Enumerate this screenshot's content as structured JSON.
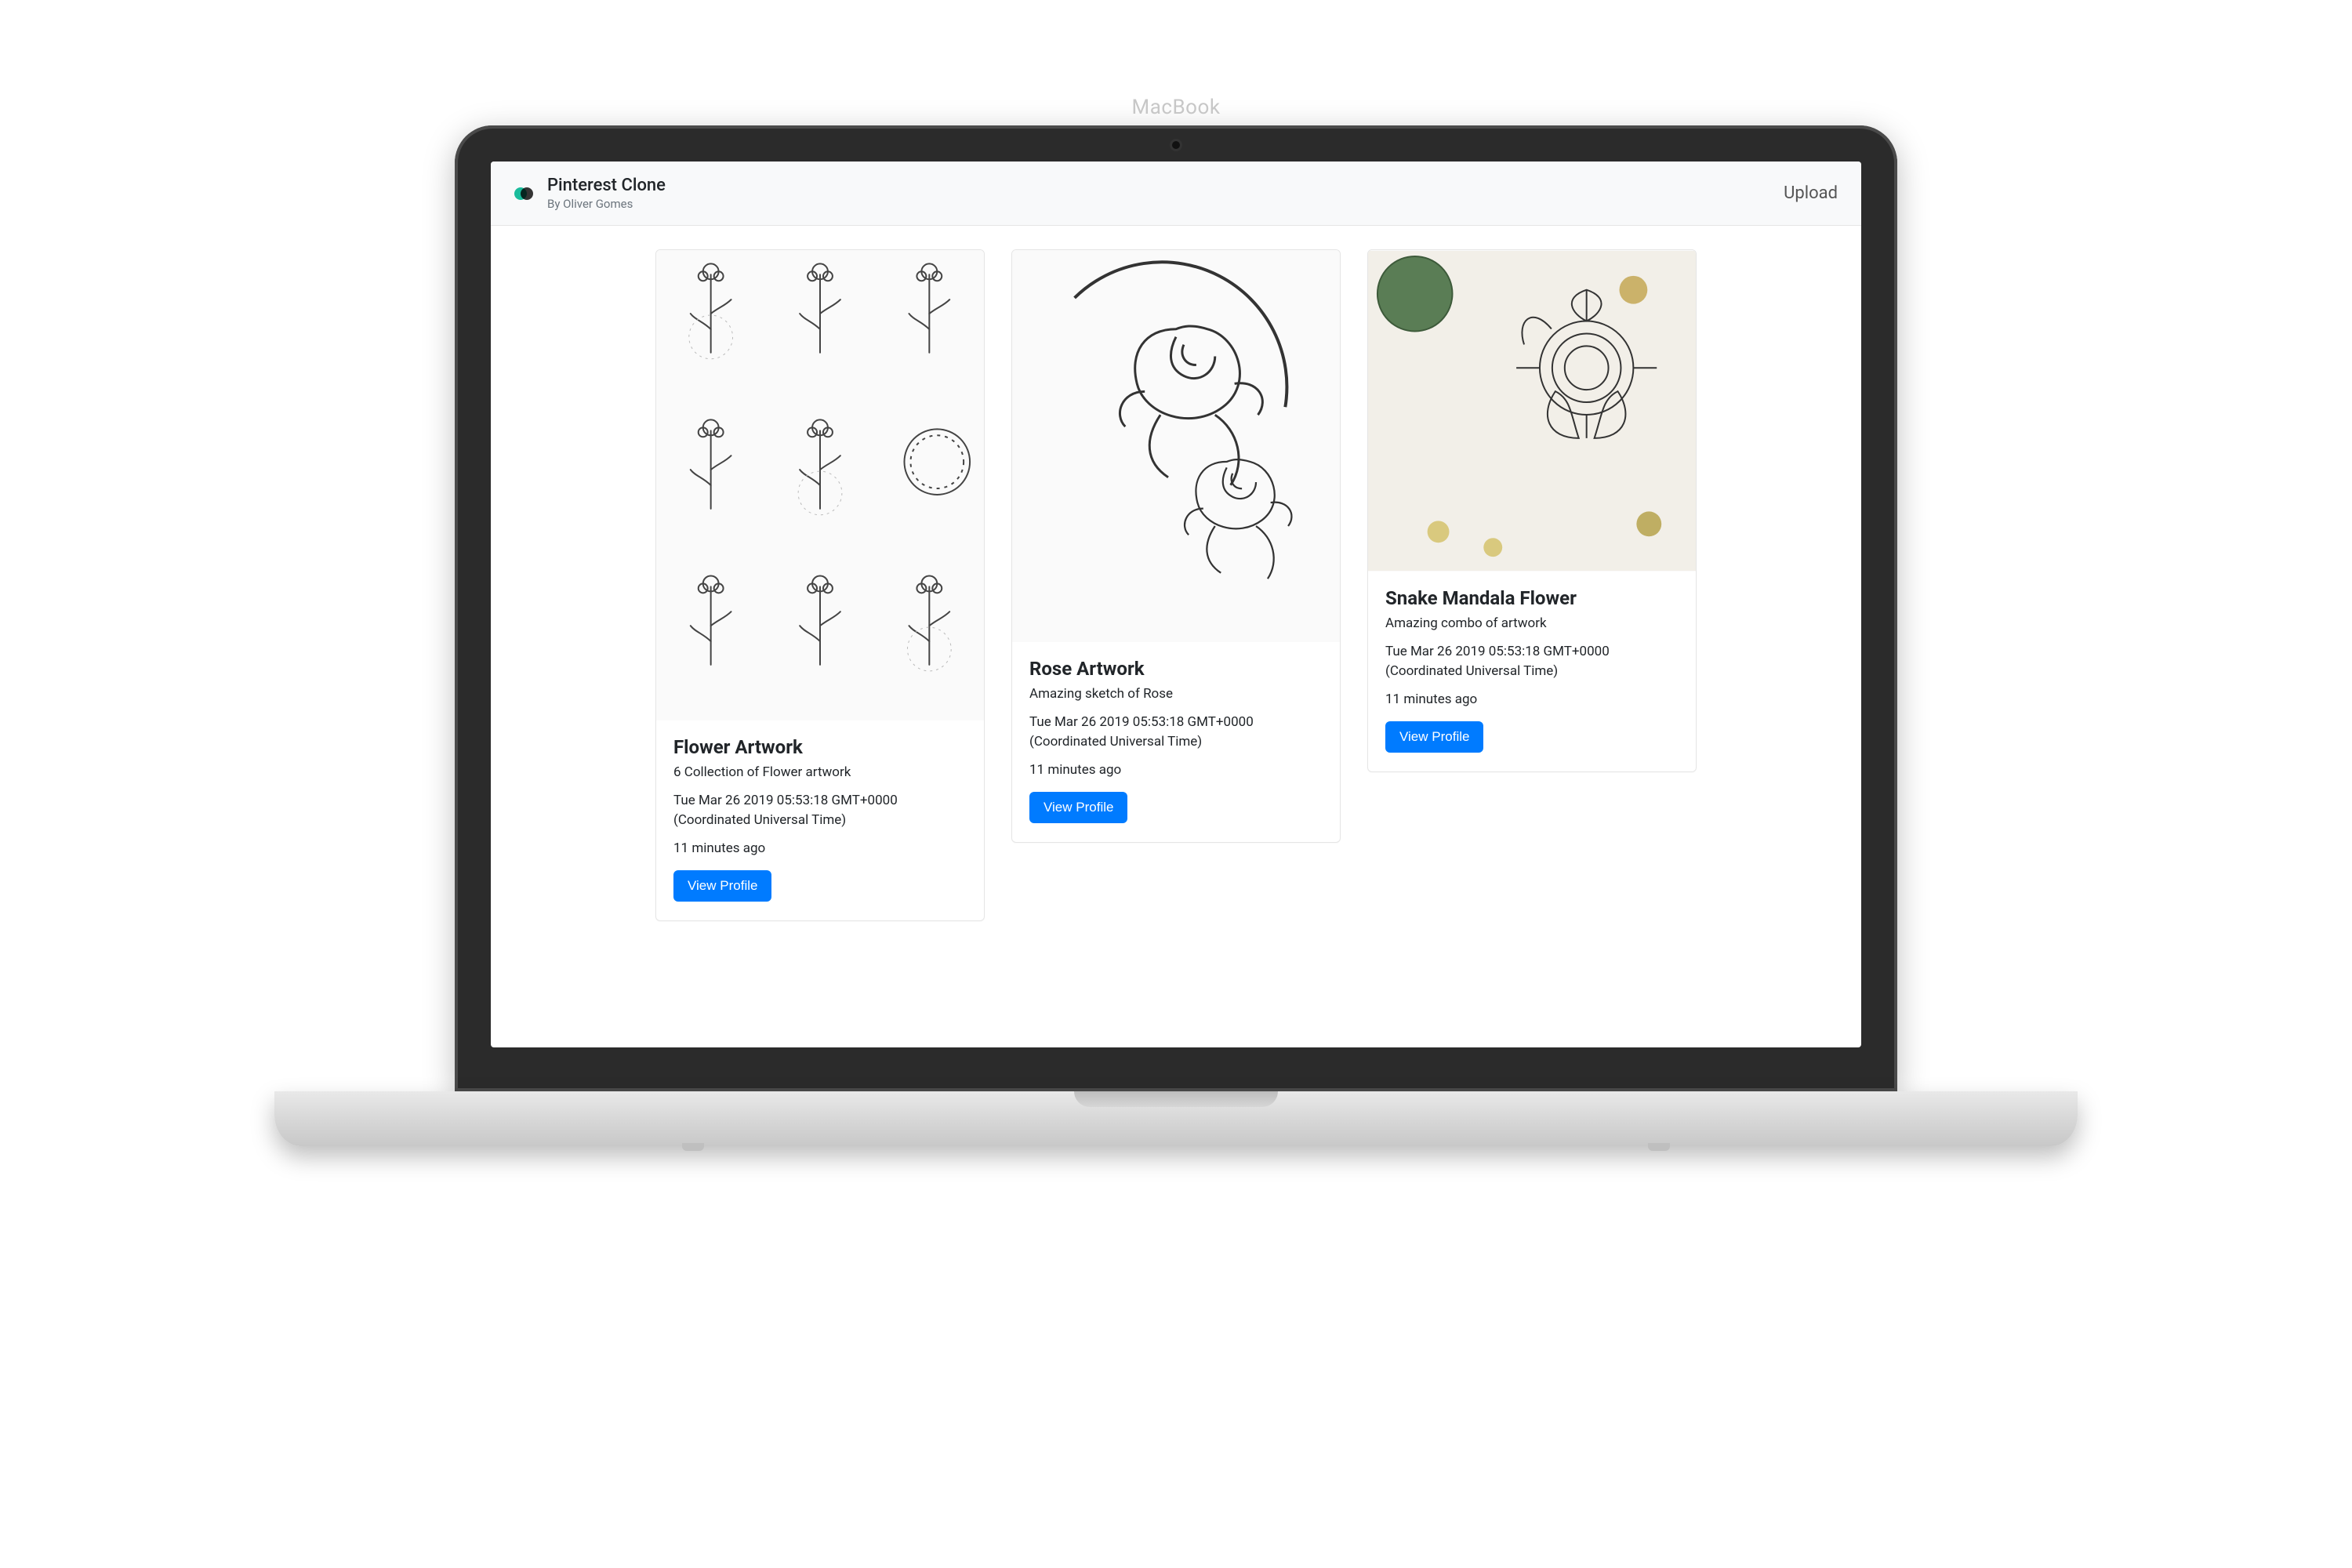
{
  "device": {
    "label": "MacBook"
  },
  "navbar": {
    "title": "Pinterest Clone",
    "subtitle": "By Oliver Gomes",
    "upload_label": "Upload"
  },
  "cards": [
    {
      "title": "Flower Artwork",
      "description": "6 Collection of Flower artwork",
      "date": "Tue Mar 26 2019 05:53:18 GMT+0000 (Coordinated Universal Time)",
      "ago": "11 minutes ago",
      "button_label": "View Profile",
      "thumb_height": "h-tall",
      "thumb_art": "flowers-grid"
    },
    {
      "title": "Rose Artwork",
      "description": "Amazing sketch of Rose",
      "date": "Tue Mar 26 2019 05:53:18 GMT+0000 (Coordinated Universal Time)",
      "ago": "11 minutes ago",
      "button_label": "View Profile",
      "thumb_height": "h-med",
      "thumb_art": "rose"
    },
    {
      "title": "Snake Mandala Flower",
      "description": "Amazing combo of artwork",
      "date": "Tue Mar 26 2019 05:53:18 GMT+0000 (Coordinated Universal Time)",
      "ago": "11 minutes ago",
      "button_label": "View Profile",
      "thumb_height": "h-short",
      "thumb_art": "mandala"
    }
  ]
}
